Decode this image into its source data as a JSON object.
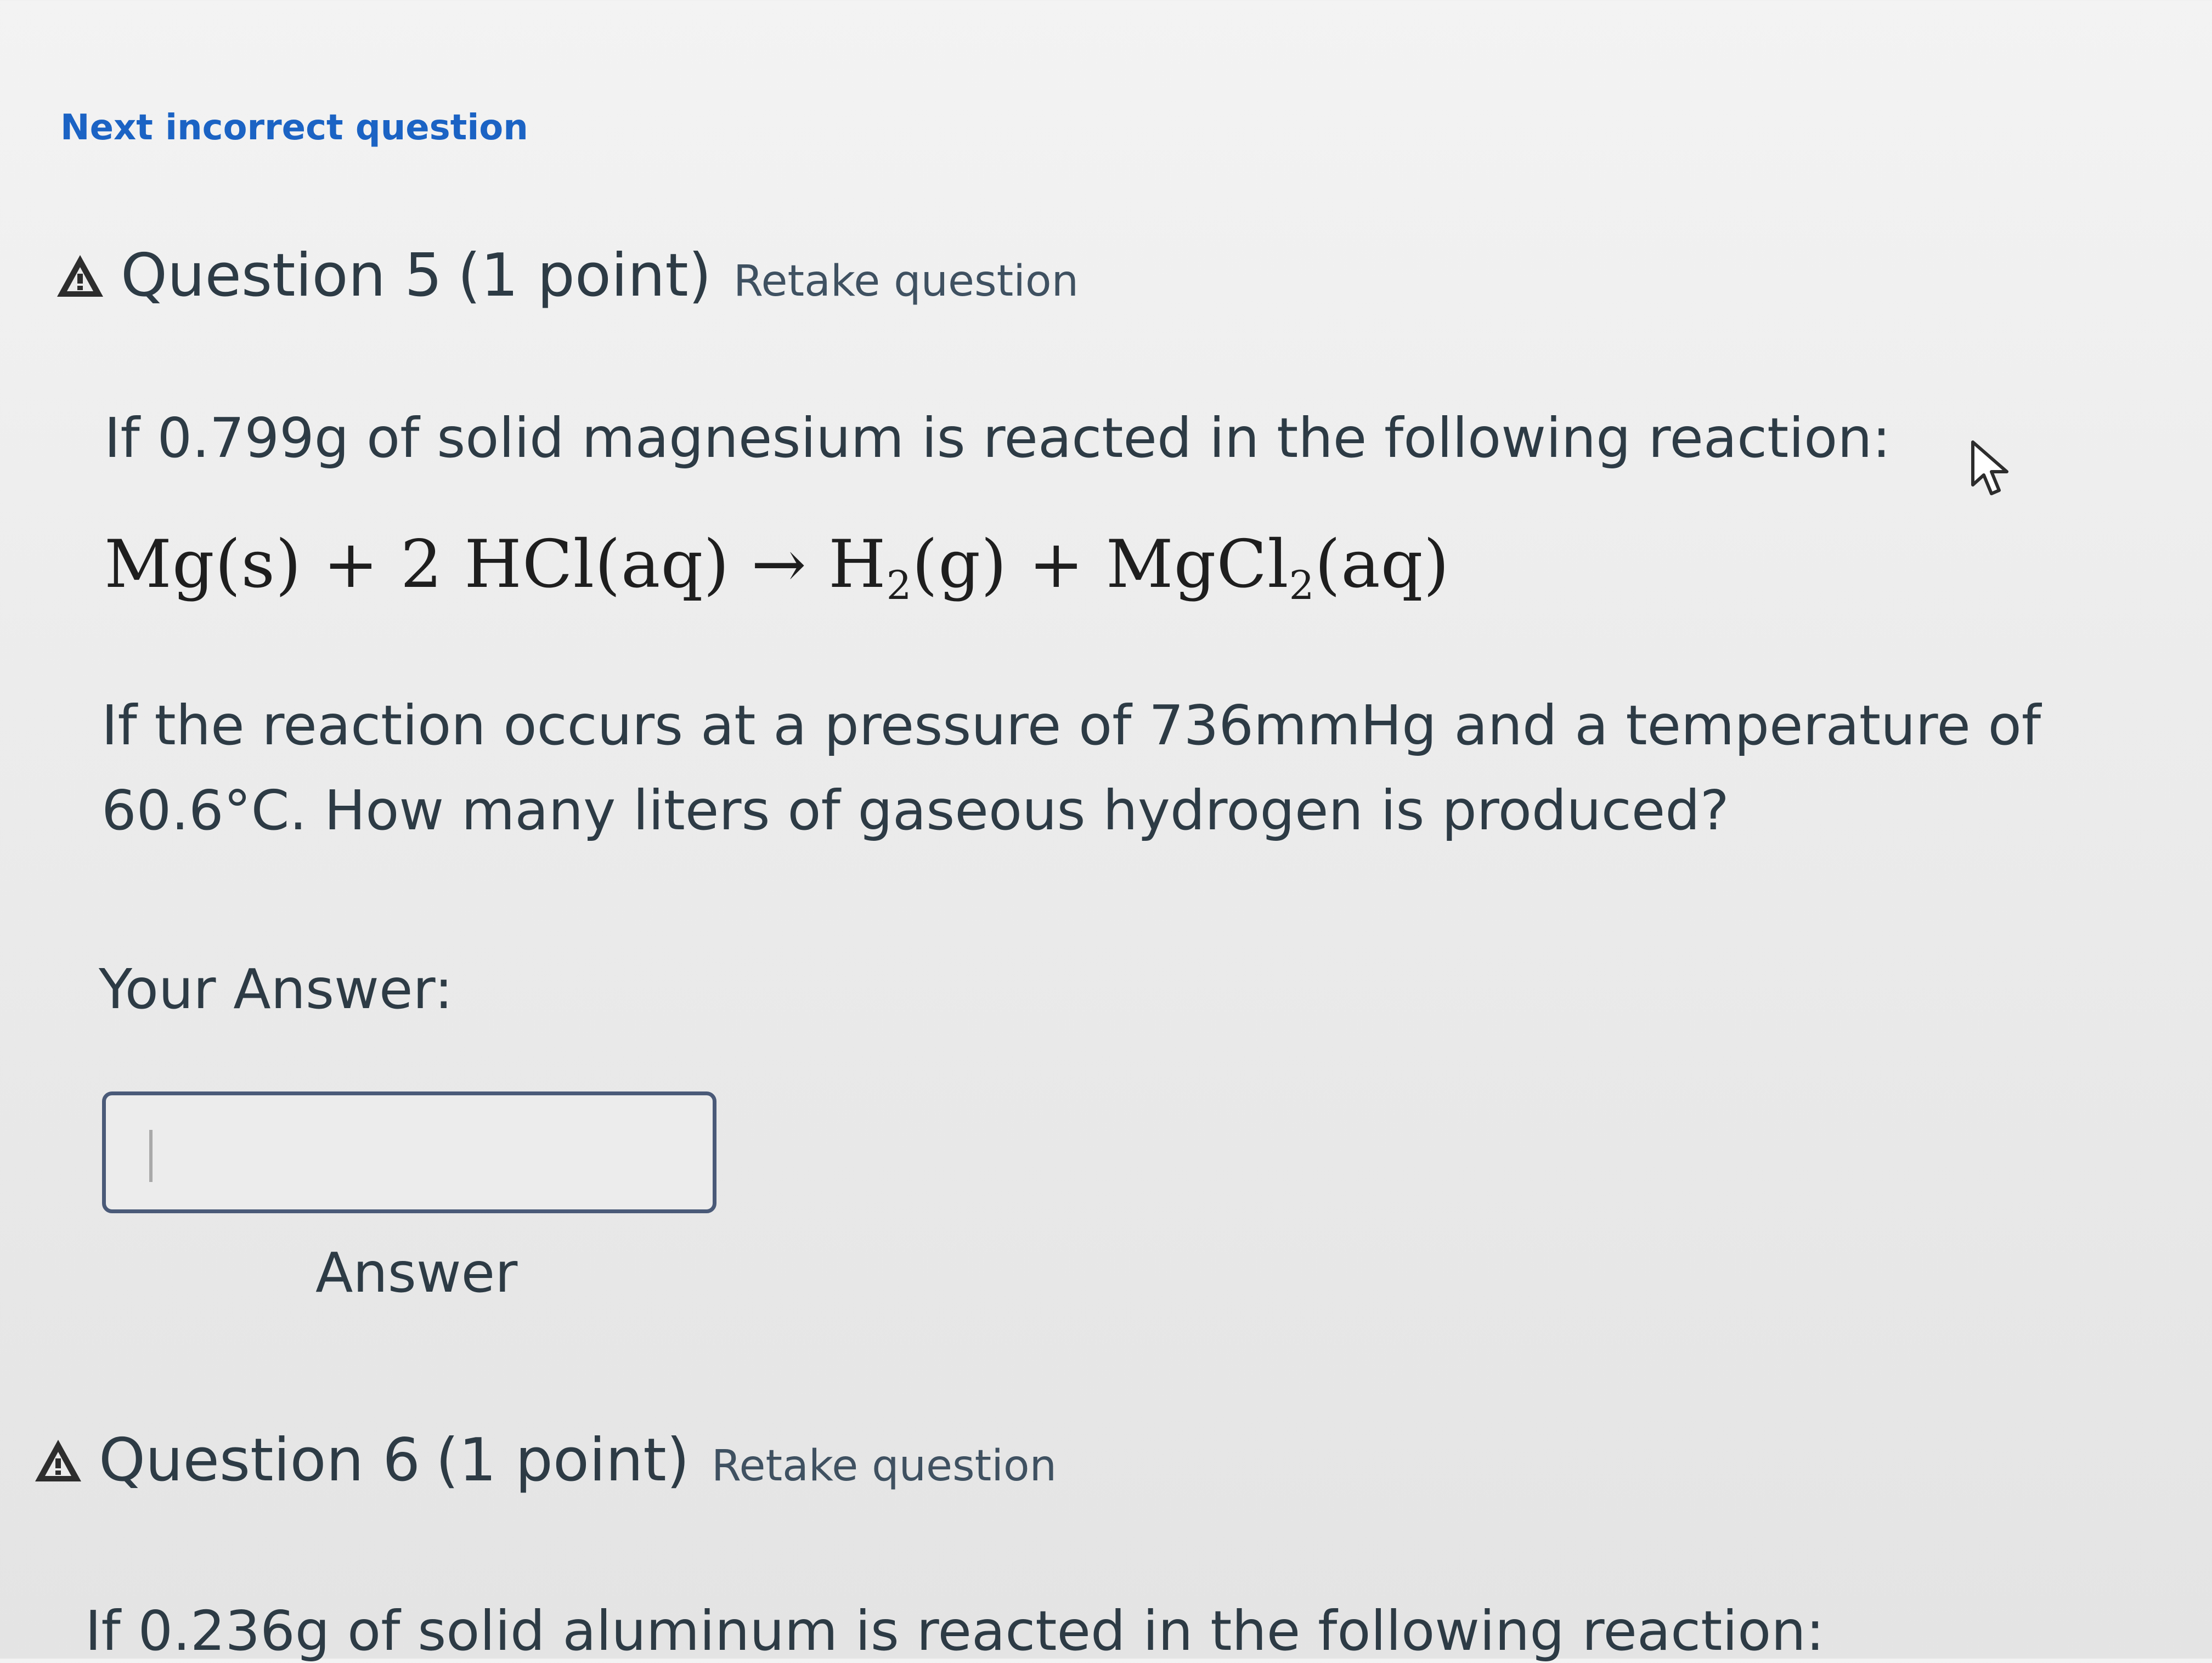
{
  "nav": {
    "next_incorrect_label": "Next incorrect question"
  },
  "question5": {
    "label": "Question 5",
    "points": "(1 point)",
    "retake_label": "Retake question",
    "prompt": "If 0.799g of solid magnesium is reacted in the following reaction:",
    "equation": {
      "term1": "Mg(s)",
      "plus1": "+",
      "term2": "2 HCl(aq)",
      "arrow": "→",
      "term3_main": "H",
      "term3_sub": "2",
      "term3_tail": "(g)",
      "plus2": "+",
      "term4_main": "MgCl",
      "term4_sub": "2",
      "term4_tail": "(aq)"
    },
    "question_text": "If the reaction occurs at a pressure of 736mmHg and a temperature of 60.6°C. How many liters of gaseous hydrogen is produced?",
    "your_answer_label": "Your Answer:",
    "answer_value": "",
    "answer_caption": "Answer"
  },
  "question6": {
    "label": "Question 6",
    "points": "(1 point)",
    "retake_label": "Retake question",
    "prompt": "If 0.236g of solid aluminum is reacted in the following reaction:"
  },
  "icons": {
    "warning": "warning-triangle-icon",
    "cursor": "mouse-pointer-icon"
  },
  "colors": {
    "link": "#1b63c4",
    "text": "#2d3b45",
    "input_border": "#4a5a78"
  }
}
